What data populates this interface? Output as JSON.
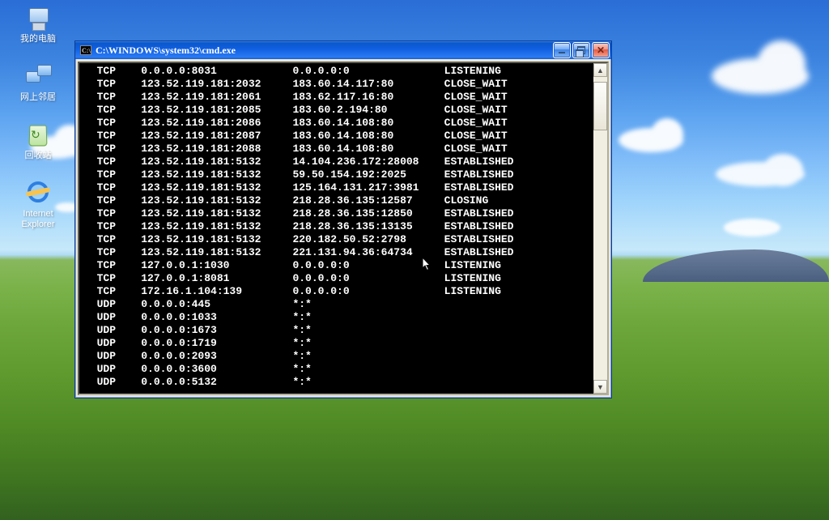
{
  "window": {
    "title": "C:\\WINDOWS\\system32\\cmd.exe",
    "appicon_text": "C:\\"
  },
  "desktop_icons": {
    "my_computer": "我的电脑",
    "network": "网上邻居",
    "recycle": "回收站",
    "ie_line1": "Internet",
    "ie_line2": "Explorer"
  },
  "netstat_rows": [
    {
      "proto": "TCP",
      "local": "0.0.0.0:8031",
      "foreign": "0.0.0.0:0",
      "state": "LISTENING"
    },
    {
      "proto": "TCP",
      "local": "123.52.119.181:2032",
      "foreign": "183.60.14.117:80",
      "state": "CLOSE_WAIT"
    },
    {
      "proto": "TCP",
      "local": "123.52.119.181:2061",
      "foreign": "183.62.117.16:80",
      "state": "CLOSE_WAIT"
    },
    {
      "proto": "TCP",
      "local": "123.52.119.181:2085",
      "foreign": "183.60.2.194:80",
      "state": "CLOSE_WAIT"
    },
    {
      "proto": "TCP",
      "local": "123.52.119.181:2086",
      "foreign": "183.60.14.108:80",
      "state": "CLOSE_WAIT"
    },
    {
      "proto": "TCP",
      "local": "123.52.119.181:2087",
      "foreign": "183.60.14.108:80",
      "state": "CLOSE_WAIT"
    },
    {
      "proto": "TCP",
      "local": "123.52.119.181:2088",
      "foreign": "183.60.14.108:80",
      "state": "CLOSE_WAIT"
    },
    {
      "proto": "TCP",
      "local": "123.52.119.181:5132",
      "foreign": "14.104.236.172:28008",
      "state": "ESTABLISHED"
    },
    {
      "proto": "TCP",
      "local": "123.52.119.181:5132",
      "foreign": "59.50.154.192:2025",
      "state": "ESTABLISHED"
    },
    {
      "proto": "TCP",
      "local": "123.52.119.181:5132",
      "foreign": "125.164.131.217:3981",
      "state": "ESTABLISHED"
    },
    {
      "proto": "TCP",
      "local": "123.52.119.181:5132",
      "foreign": "218.28.36.135:12587",
      "state": "CLOSING"
    },
    {
      "proto": "TCP",
      "local": "123.52.119.181:5132",
      "foreign": "218.28.36.135:12850",
      "state": "ESTABLISHED"
    },
    {
      "proto": "TCP",
      "local": "123.52.119.181:5132",
      "foreign": "218.28.36.135:13135",
      "state": "ESTABLISHED"
    },
    {
      "proto": "TCP",
      "local": "123.52.119.181:5132",
      "foreign": "220.182.50.52:2798",
      "state": "ESTABLISHED"
    },
    {
      "proto": "TCP",
      "local": "123.52.119.181:5132",
      "foreign": "221.131.94.36:64734",
      "state": "ESTABLISHED"
    },
    {
      "proto": "TCP",
      "local": "127.0.0.1:1030",
      "foreign": "0.0.0.0:0",
      "state": "LISTENING"
    },
    {
      "proto": "TCP",
      "local": "127.0.0.1:8081",
      "foreign": "0.0.0.0:0",
      "state": "LISTENING"
    },
    {
      "proto": "TCP",
      "local": "172.16.1.104:139",
      "foreign": "0.0.0.0:0",
      "state": "LISTENING"
    },
    {
      "proto": "UDP",
      "local": "0.0.0.0:445",
      "foreign": "*:*",
      "state": ""
    },
    {
      "proto": "UDP",
      "local": "0.0.0.0:1033",
      "foreign": "*:*",
      "state": ""
    },
    {
      "proto": "UDP",
      "local": "0.0.0.0:1673",
      "foreign": "*:*",
      "state": ""
    },
    {
      "proto": "UDP",
      "local": "0.0.0.0:1719",
      "foreign": "*:*",
      "state": ""
    },
    {
      "proto": "UDP",
      "local": "0.0.0.0:2093",
      "foreign": "*:*",
      "state": ""
    },
    {
      "proto": "UDP",
      "local": "0.0.0.0:3600",
      "foreign": "*:*",
      "state": ""
    },
    {
      "proto": "UDP",
      "local": "0.0.0.0:5132",
      "foreign": "*:*",
      "state": ""
    }
  ],
  "columns": {
    "c1": 2,
    "c2": 9,
    "c3": 33,
    "c4": 57
  }
}
